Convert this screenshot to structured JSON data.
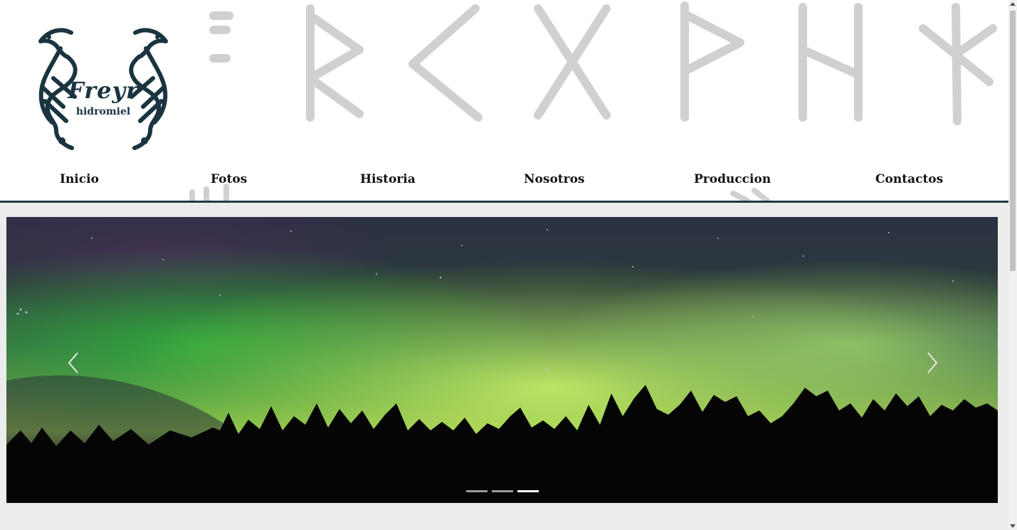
{
  "brand": {
    "title": "Freyr",
    "subtitle": "hidromiel",
    "logo_icon": "dragon-knot-logo-icon",
    "color": "#1b3440"
  },
  "header": {
    "rune_icon": "runes-decoration-icon",
    "rune_color": "#d0d0d0"
  },
  "nav": {
    "items": [
      {
        "label": "Inicio"
      },
      {
        "label": "Fotos"
      },
      {
        "label": "Historia"
      },
      {
        "label": "Nosotros"
      },
      {
        "label": "Produccion"
      },
      {
        "label": "Contactos"
      }
    ],
    "underline_color": "#1f3a44"
  },
  "carousel": {
    "slide_icon": "aurora-forest-image",
    "prev_icon": "chevron-left-icon",
    "next_icon": "chevron-right-icon",
    "slide_count": 3,
    "active_index": 3
  }
}
